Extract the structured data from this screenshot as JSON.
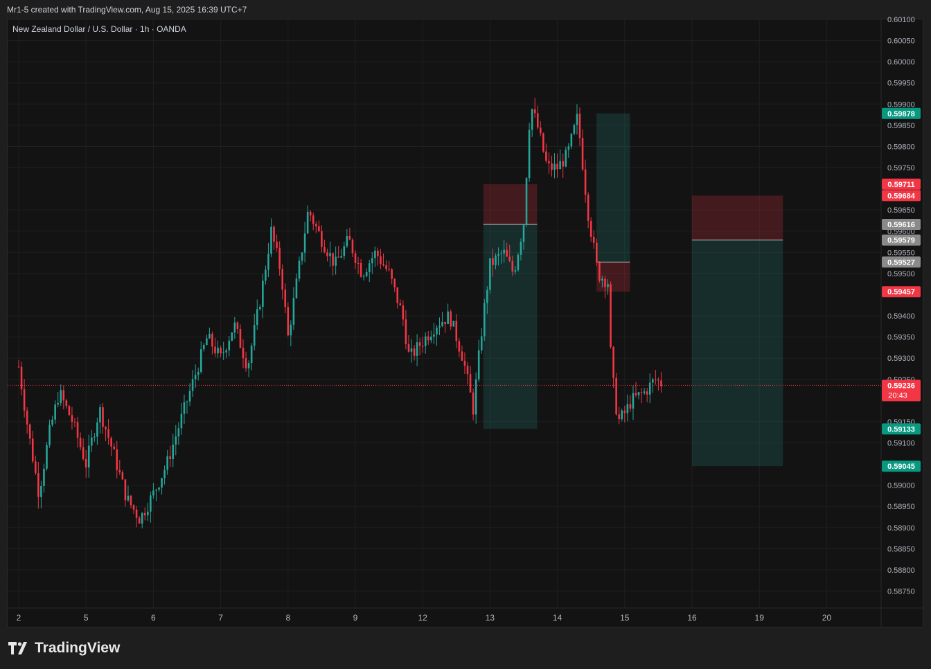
{
  "header": {
    "caption": "Mr1-5 created with TradingView.com, Aug 15, 2025 16:39 UTC+7"
  },
  "symbol_title": "New Zealand Dollar / U.S. Dollar · 1h · OANDA",
  "brand": {
    "name": "TradingView",
    "icon": "tradingview-logo-icon"
  },
  "colors": {
    "up": "#26a69a",
    "down": "#f23645",
    "background": "#131313",
    "grid": "#1f1f1f",
    "text": "#b2b5be",
    "target_zone": "rgba(38,166,154,0.18)",
    "stop_zone": "rgba(242,54,69,0.22)"
  },
  "chart_data": {
    "type": "candlestick",
    "title": "New Zealand Dollar / U.S. Dollar · 1h · OANDA",
    "x_ticks": [
      "2",
      "5",
      "6",
      "7",
      "8",
      "9",
      "12",
      "13",
      "14",
      "15",
      "16",
      "19",
      "20"
    ],
    "y_ticks": [
      "0.58750",
      "0.58800",
      "0.58850",
      "0.58900",
      "0.58950",
      "0.59000",
      "0.59100",
      "0.59150",
      "0.59250",
      "0.59300",
      "0.59350",
      "0.59400",
      "0.59500",
      "0.59550",
      "0.59600",
      "0.59650",
      "0.59750",
      "0.59800",
      "0.59850",
      "0.59900",
      "0.59950",
      "0.60000",
      "0.60050",
      "0.60100"
    ],
    "y_range": [
      0.5871,
      0.601
    ],
    "grid": true,
    "current_price": {
      "value": "0.59236",
      "countdown": "20:43"
    },
    "price_labels": [
      {
        "value": "0.59878",
        "kind": "target"
      },
      {
        "value": "0.59711",
        "kind": "stop"
      },
      {
        "value": "0.59684",
        "kind": "stop"
      },
      {
        "value": "0.59616",
        "kind": "entry"
      },
      {
        "value": "0.59579",
        "kind": "entry"
      },
      {
        "value": "0.59527",
        "kind": "entry"
      },
      {
        "value": "0.59457",
        "kind": "stop"
      },
      {
        "value": "0.59133",
        "kind": "target"
      },
      {
        "value": "0.59045",
        "kind": "target"
      }
    ],
    "positions": [
      {
        "side": "long",
        "day_start": 6.9,
        "day_end": 7.7,
        "entry": 0.59616,
        "stop": 0.59711,
        "target": 0.59133
      },
      {
        "side": "short",
        "day_start": 8.58,
        "day_end": 9.08,
        "entry": 0.59527,
        "stop": 0.59457,
        "target": 0.59878
      },
      {
        "side": "short",
        "day_start": 10.0,
        "day_end": 11.35,
        "entry": 0.59579,
        "stop": 0.59684,
        "target": 0.59045
      }
    ],
    "series": [
      {
        "name": "",
        "kind": "close_path",
        "points": [
          [
            0,
            0.5928
          ],
          [
            0.15,
            0.5912
          ],
          [
            0.3,
            0.5898
          ],
          [
            0.45,
            0.5912
          ],
          [
            0.6,
            0.5922
          ],
          [
            0.8,
            0.5915
          ],
          [
            1.0,
            0.5905
          ],
          [
            1.2,
            0.5918
          ],
          [
            1.4,
            0.5908
          ],
          [
            1.6,
            0.5897
          ],
          [
            1.8,
            0.5892
          ],
          [
            2.0,
            0.5898
          ],
          [
            2.2,
            0.5905
          ],
          [
            2.4,
            0.5915
          ],
          [
            2.6,
            0.5925
          ],
          [
            2.8,
            0.5935
          ],
          [
            3.0,
            0.593
          ],
          [
            3.2,
            0.5938
          ],
          [
            3.4,
            0.5928
          ],
          [
            3.6,
            0.5945
          ],
          [
            3.75,
            0.596
          ],
          [
            3.9,
            0.595
          ],
          [
            4.0,
            0.5935
          ],
          [
            4.2,
            0.5955
          ],
          [
            4.3,
            0.5965
          ],
          [
            4.5,
            0.5958
          ],
          [
            4.7,
            0.5952
          ],
          [
            4.9,
            0.5958
          ],
          [
            5.1,
            0.595
          ],
          [
            5.3,
            0.5955
          ],
          [
            5.5,
            0.595
          ],
          [
            5.7,
            0.594
          ],
          [
            5.8,
            0.593
          ],
          [
            6.0,
            0.5934
          ],
          [
            6.2,
            0.5938
          ],
          [
            6.4,
            0.594
          ],
          [
            6.6,
            0.593
          ],
          [
            6.75,
            0.5918
          ],
          [
            6.9,
            0.594
          ],
          [
            7.0,
            0.5952
          ],
          [
            7.2,
            0.5955
          ],
          [
            7.35,
            0.595
          ],
          [
            7.5,
            0.5962
          ],
          [
            7.6,
            0.599
          ],
          [
            7.7,
            0.5985
          ],
          [
            7.85,
            0.5975
          ],
          [
            8.0,
            0.5975
          ],
          [
            8.15,
            0.5978
          ],
          [
            8.3,
            0.5987
          ],
          [
            8.45,
            0.5965
          ],
          [
            8.6,
            0.595
          ],
          [
            8.75,
            0.5948
          ],
          [
            8.8,
            0.5928
          ],
          [
            8.9,
            0.5915
          ],
          [
            9.0,
            0.5917
          ],
          [
            9.1,
            0.592
          ],
          [
            9.3,
            0.5922
          ],
          [
            9.45,
            0.5925
          ],
          [
            9.55,
            0.5924
          ]
        ]
      }
    ]
  }
}
